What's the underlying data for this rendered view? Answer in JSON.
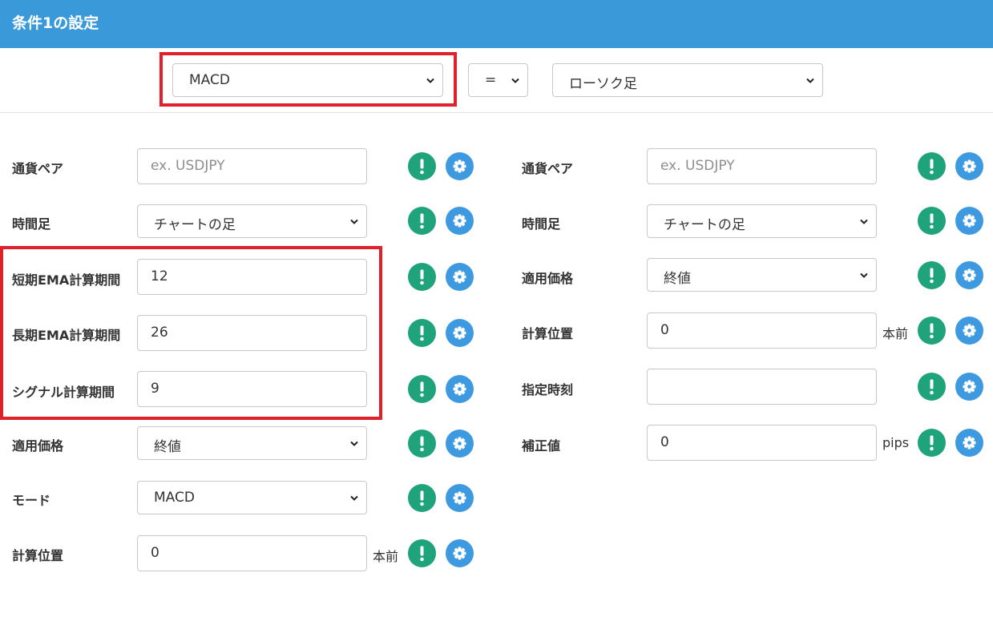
{
  "header": {
    "title": "条件1の設定"
  },
  "top": {
    "indicator": "MACD",
    "operator": "=",
    "target": "ローソク足"
  },
  "left": {
    "pair": {
      "label": "通貨ペア",
      "placeholder": "ex. USDJPY"
    },
    "timeframe": {
      "label": "時間足",
      "value": "チャートの足"
    },
    "short_ema": {
      "label": "短期EMA計算期間",
      "value": "12"
    },
    "long_ema": {
      "label": "長期EMA計算期間",
      "value": "26"
    },
    "signal": {
      "label": "シグナル計算期間",
      "value": "9"
    },
    "price": {
      "label": "適用価格",
      "value": "終値"
    },
    "mode": {
      "label": "モード",
      "value": "MACD"
    },
    "position": {
      "label": "計算位置",
      "value": "0",
      "unit": "本前"
    }
  },
  "right": {
    "pair": {
      "label": "通貨ペア",
      "placeholder": "ex. USDJPY"
    },
    "timeframe": {
      "label": "時間足",
      "value": "チャートの足"
    },
    "price": {
      "label": "適用価格",
      "value": "終値"
    },
    "position": {
      "label": "計算位置",
      "value": "0",
      "unit": "本前"
    },
    "time": {
      "label": "指定時刻",
      "value": ""
    },
    "offset": {
      "label": "補正値",
      "value": "0",
      "unit": "pips"
    }
  },
  "icons": {
    "info": "exclamation-icon",
    "settings": "gear-icon"
  },
  "colors": {
    "header": "#3a99d8",
    "info": "#1fa37b",
    "settings": "#3d9ae0",
    "highlight": "#e0212b"
  }
}
